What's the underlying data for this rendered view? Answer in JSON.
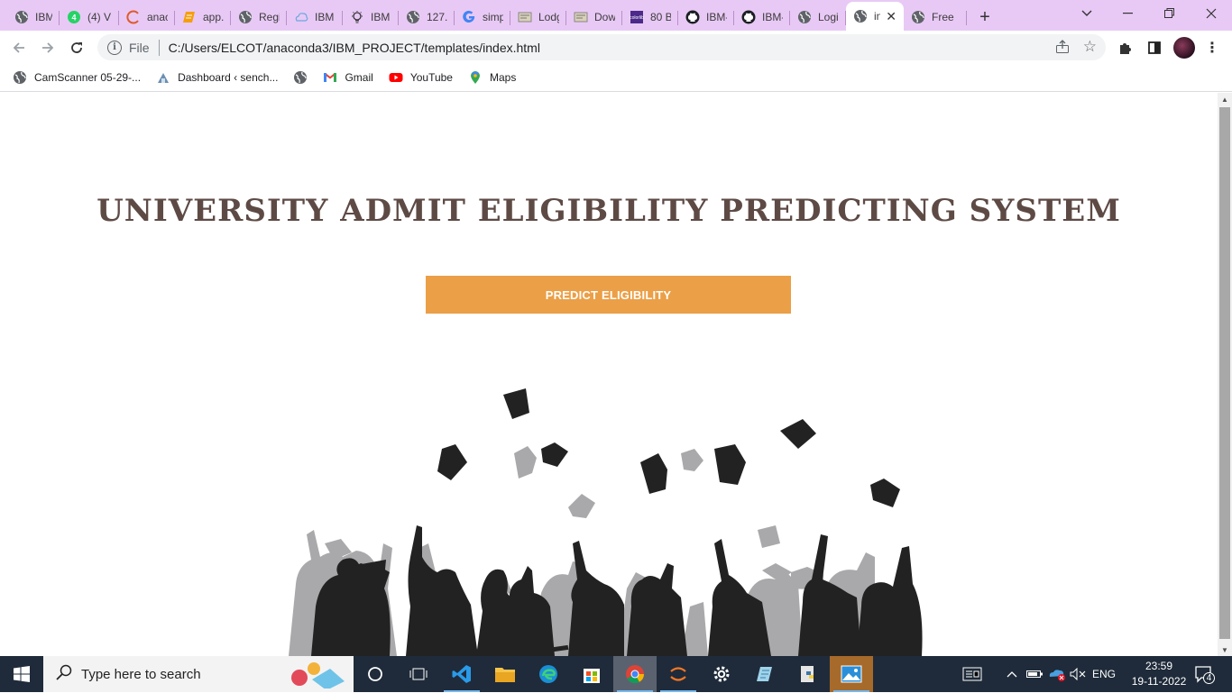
{
  "browser": {
    "tabs": [
      {
        "label": "IBM",
        "icon": "globe-icon"
      },
      {
        "label": "(4) V",
        "icon": "whatsapp-icon"
      },
      {
        "label": "anac",
        "icon": "anaconda-icon"
      },
      {
        "label": "app.",
        "icon": "book-icon"
      },
      {
        "label": "Regi",
        "icon": "globe-icon"
      },
      {
        "label": "IBM",
        "icon": "cloud-icon"
      },
      {
        "label": "IBM",
        "icon": "bulb-icon"
      },
      {
        "label": "127.",
        "icon": "globe-icon"
      },
      {
        "label": "simp",
        "icon": "google-icon"
      },
      {
        "label": "Lodg",
        "icon": "image-icon"
      },
      {
        "label": "Dow",
        "icon": "image-icon"
      },
      {
        "label": "80 B",
        "icon": "colorlib-icon"
      },
      {
        "label": "IBM-",
        "icon": "github-icon"
      },
      {
        "label": "IBM-",
        "icon": "github-icon"
      },
      {
        "label": "Logi",
        "icon": "globe-icon"
      },
      {
        "label": "in",
        "icon": "globe-icon",
        "active": true
      },
      {
        "label": "Free",
        "icon": "globe-icon"
      }
    ],
    "omnibox": {
      "scheme": "File",
      "url": "C:/Users/ELCOT/anaconda3/IBM_PROJECT/templates/index.html"
    },
    "bookmarks": [
      {
        "label": "CamScanner 05-29-...",
        "icon": "globe-icon"
      },
      {
        "label": "Dashboard ‹ sench...",
        "icon": "site-icon"
      },
      {
        "label": "",
        "icon": "globe-icon"
      },
      {
        "label": "Gmail",
        "icon": "gmail-icon"
      },
      {
        "label": "YouTube",
        "icon": "youtube-icon"
      },
      {
        "label": "Maps",
        "icon": "maps-icon"
      }
    ]
  },
  "page": {
    "heading": "UNIVERSITY ADMIT ELIGIBILITY PREDICTING SYSTEM",
    "cta_label": "PREDICT ELIGIBILITY",
    "colors": {
      "heading": "#5e4a45",
      "cta": "#eb9f47",
      "tabstrip": "#e8c9f5"
    }
  },
  "taskbar": {
    "search_placeholder": "Type here to search",
    "language": "ENG",
    "time": "23:59",
    "date": "19-11-2022",
    "notification_count": "4"
  }
}
